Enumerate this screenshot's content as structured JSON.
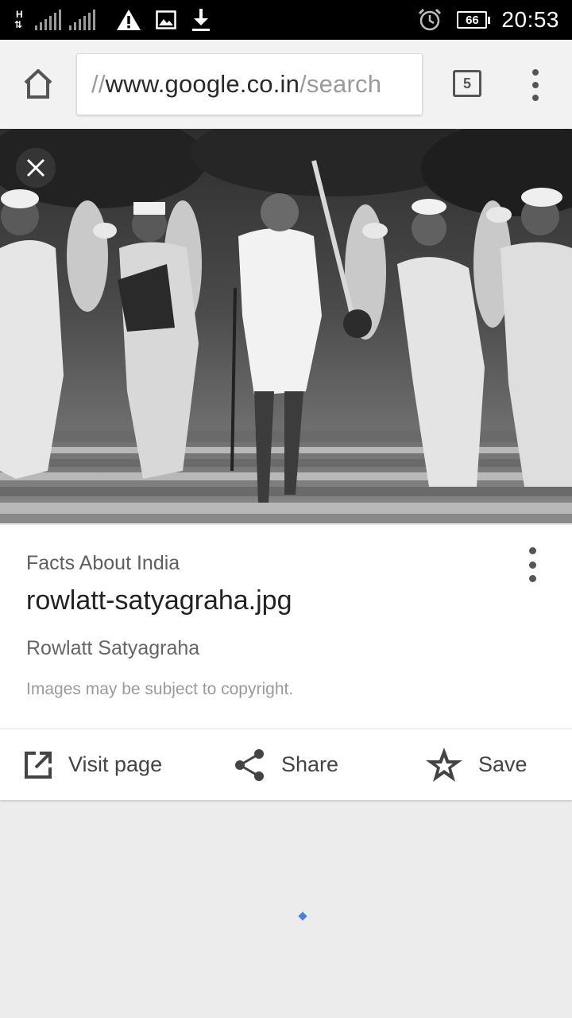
{
  "status_bar": {
    "network_type": "H",
    "battery_level": "66",
    "time": "20:53",
    "icons": [
      "network-h-icon",
      "signal-bars-icon",
      "warning-icon",
      "image-icon",
      "download-icon",
      "alarm-icon",
      "battery-icon"
    ]
  },
  "browser": {
    "url_prefix": "//",
    "url_host": "www.google.co.in",
    "url_path": "/search",
    "tab_count": "5"
  },
  "image_viewer": {
    "image_description": "Black and white photograph of Rowlatt Satyagraha march",
    "source": "Facts About India",
    "filename": "rowlatt-satyagraha.jpg",
    "title": "Rowlatt Satyagraha",
    "copyright_notice": "Images may be subject to copyright.",
    "actions": {
      "visit": "Visit page",
      "share": "Share",
      "save": "Save"
    }
  },
  "colors": {
    "status_bar_bg": "#000000",
    "toolbar_bg": "#f2f2f2",
    "page_bg": "#ececec",
    "spinner": "#4a7fe0"
  }
}
